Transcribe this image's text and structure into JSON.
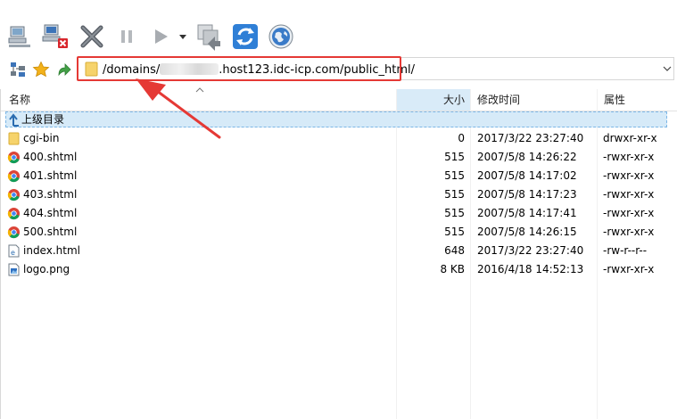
{
  "toolbar": {
    "buttons": [
      "connect-icon",
      "disconnect-icon",
      "cancel-icon",
      "pause-icon",
      "play-icon",
      "dropdown-icon",
      "queue-icon",
      "refresh-icon",
      "globe-icon"
    ]
  },
  "address": {
    "path_prefix": "/domains/",
    "path_suffix": ".host123.idc-icp.com/public_html/"
  },
  "columns": {
    "name": "名称",
    "size": "大小",
    "modified": "修改时间",
    "attributes": "属性"
  },
  "files": [
    {
      "name": "上级目录",
      "size": "",
      "modified": "",
      "perm": "",
      "icon": "up-arrow-icon"
    },
    {
      "name": "cgi-bin",
      "size": "0",
      "modified": "2017/3/22 23:27:40",
      "perm": "drwxr-xr-x",
      "icon": "folder-icon"
    },
    {
      "name": "400.shtml",
      "size": "515",
      "modified": "2007/5/8 14:26:22",
      "perm": "-rwxr-xr-x",
      "icon": "chrome-icon"
    },
    {
      "name": "401.shtml",
      "size": "515",
      "modified": "2007/5/8 14:17:02",
      "perm": "-rwxr-xr-x",
      "icon": "chrome-icon"
    },
    {
      "name": "403.shtml",
      "size": "515",
      "modified": "2007/5/8 14:17:23",
      "perm": "-rwxr-xr-x",
      "icon": "chrome-icon"
    },
    {
      "name": "404.shtml",
      "size": "515",
      "modified": "2007/5/8 14:17:41",
      "perm": "-rwxr-xr-x",
      "icon": "chrome-icon"
    },
    {
      "name": "500.shtml",
      "size": "515",
      "modified": "2007/5/8 14:26:15",
      "perm": "-rwxr-xr-x",
      "icon": "chrome-icon"
    },
    {
      "name": "index.html",
      "size": "648",
      "modified": "2017/3/22 23:27:40",
      "perm": "-rw-r--r--",
      "icon": "html-file-icon"
    },
    {
      "name": "logo.png",
      "size": "8 KB",
      "modified": "2016/4/18 14:52:13",
      "perm": "-rwxr-xr-x",
      "icon": "image-file-icon"
    }
  ],
  "colors": {
    "annotation": "#e53935",
    "selection": "#d6eaf8",
    "folder": "#f4c542"
  }
}
